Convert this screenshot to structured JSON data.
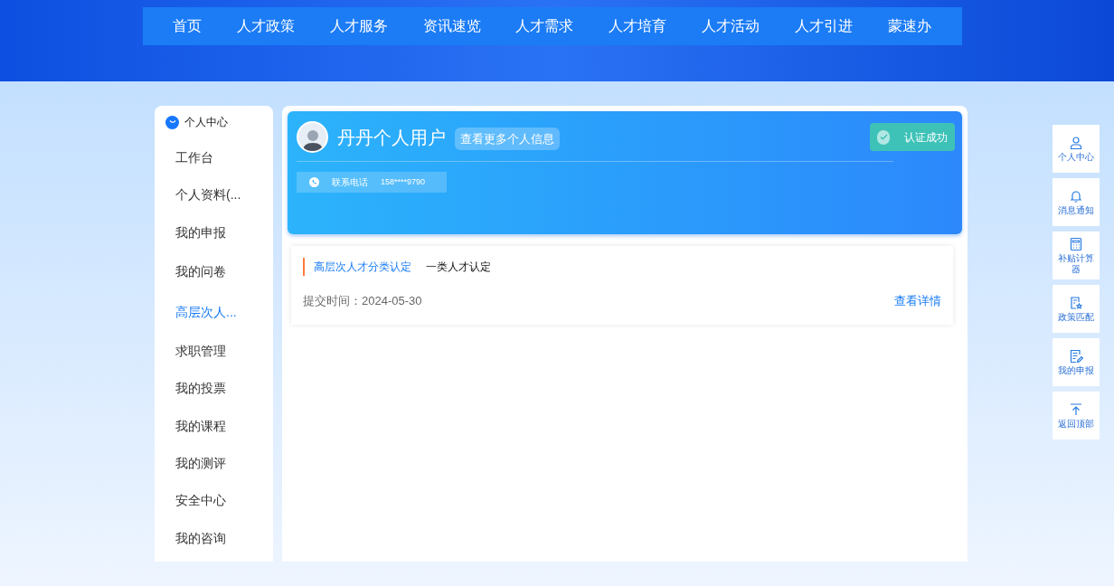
{
  "nav": [
    {
      "label": "首页"
    },
    {
      "label": "人才政策"
    },
    {
      "label": "人才服务"
    },
    {
      "label": "资讯速览"
    },
    {
      "label": "人才需求"
    },
    {
      "label": "人才培育"
    },
    {
      "label": "人才活动"
    },
    {
      "label": "人才引进"
    },
    {
      "label": "蒙速办"
    }
  ],
  "sidebar": {
    "title": "个人中心",
    "items": [
      {
        "label": "工作台",
        "selected": false
      },
      {
        "label": "个人资料(...",
        "selected": false
      },
      {
        "label": "我的申报",
        "selected": false
      },
      {
        "label": "我的问卷",
        "selected": false
      },
      {
        "label": "高层次人...",
        "selected": true
      },
      {
        "label": "求职管理",
        "selected": false
      },
      {
        "label": "我的投票",
        "selected": false
      },
      {
        "label": "我的课程",
        "selected": false
      },
      {
        "label": "我的测评",
        "selected": false
      },
      {
        "label": "安全中心",
        "selected": false
      },
      {
        "label": "我的咨询",
        "selected": false
      }
    ]
  },
  "profile": {
    "name": "丹丹个人用户",
    "more_button": "查看更多个人信息",
    "phone_label": "联系电话",
    "phone": "158****9790",
    "status": "认证成功"
  },
  "record": {
    "category": "高层次人才分类认定",
    "type": "一类人才认定",
    "submitted": "提交时间：2024-05-30",
    "details_link": "查看详情"
  },
  "tools": [
    {
      "kind": "user",
      "label": "个人中心"
    },
    {
      "kind": "bell",
      "label": "消息通知"
    },
    {
      "kind": "calculator",
      "label": "补贴计算器"
    },
    {
      "kind": "policy",
      "label": "政策匹配"
    },
    {
      "kind": "edit",
      "label": "我的申报"
    },
    {
      "kind": "top",
      "label": "返回顶部"
    }
  ]
}
